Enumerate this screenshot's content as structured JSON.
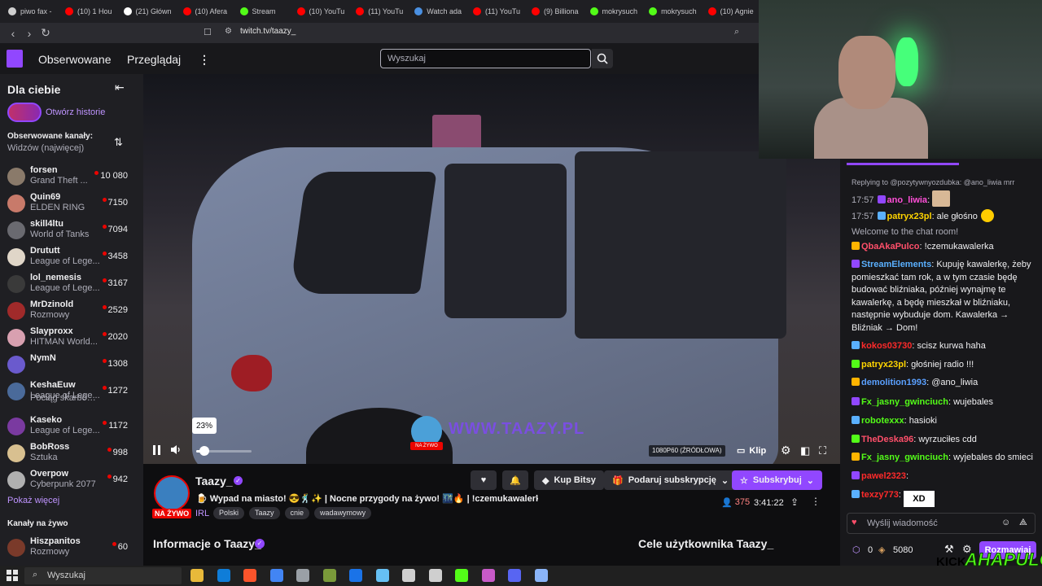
{
  "browser": {
    "tabs": [
      {
        "label": "piwo fax -",
        "color": "#cfcfcf"
      },
      {
        "label": "(10) 1 Hou",
        "color": "#ff0000"
      },
      {
        "label": "(21) Główn",
        "color": "#ffffff"
      },
      {
        "label": "(10) Afera",
        "color": "#ff0000"
      },
      {
        "label": "Stream",
        "color": "#53fc18"
      },
      {
        "label": "(10) YouTu",
        "color": "#ff0000"
      },
      {
        "label": "(11) YouTu",
        "color": "#ff0000"
      },
      {
        "label": "Watch ada",
        "color": "#4a90e2"
      },
      {
        "label": "(11) YouTu",
        "color": "#ff0000"
      },
      {
        "label": "(9) Billiona",
        "color": "#ff0000"
      },
      {
        "label": "mokrysuch",
        "color": "#53fc18"
      },
      {
        "label": "mokrysuch",
        "color": "#53fc18"
      },
      {
        "label": "(10) Agnie",
        "color": "#ff0000"
      }
    ],
    "url": "twitch.tv/taazy_"
  },
  "topnav": {
    "followed": "Obserwowane",
    "browse": "Przeglądaj",
    "more": "⋮",
    "search_placeholder": "Wyszukaj"
  },
  "sidebar": {
    "for_you": "Dla ciebie",
    "collapse": "⇤",
    "stories": "Otwórz historie",
    "followed_label": "Obserwowane kanały:",
    "sort_label": "Widzów (najwięcej)",
    "sort_icon": "⇅",
    "channels": [
      {
        "name": "forsen",
        "game": "Grand Theft ...",
        "viewers": "10 080",
        "color": "#8a7a6a"
      },
      {
        "name": "Quin69",
        "game": "ELDEN RING",
        "viewers": "7150",
        "color": "#c87a6a"
      },
      {
        "name": "skill4ltu",
        "game": "World of Tanks",
        "viewers": "7094",
        "color": "#6a6a70"
      },
      {
        "name": "Drututt",
        "game": "League of Lege...",
        "viewers": "3458",
        "color": "#e0d6c8"
      },
      {
        "name": "lol_nemesis",
        "game": "League of Lege...",
        "viewers": "3167",
        "color": "#3a3a3a"
      },
      {
        "name": "MrDzinold",
        "game": "Rozmowy",
        "viewers": "2529",
        "color": "#a02a2a"
      },
      {
        "name": "Slayproxx",
        "game": "HITMAN World...",
        "viewers": "2020",
        "color": "#d8a0b0"
      },
      {
        "name": "NymN",
        "game": "",
        "viewers": "1308",
        "color": "#6a5acd"
      },
      {
        "name": "KeshaEuw",
        "game": "League of Lege...",
        "viewers": "1272",
        "color": "#4a6a9a"
      },
      {
        "name": "",
        "game": "Pociąg skarbów • P...",
        "viewers": "",
        "color": ""
      },
      {
        "name": "Kaseko",
        "game": "League of Lege...",
        "viewers": "1172",
        "color": "#7a3aa0"
      },
      {
        "name": "BobRoss",
        "game": "Sztuka",
        "viewers": "998",
        "color": "#d8c090"
      },
      {
        "name": "Overpow",
        "game": "Cyberpunk 2077",
        "viewers": "942",
        "color": "#b0b0b0"
      }
    ],
    "show_more": "Pokaż więcej",
    "live_channels": "Kanały na żywo",
    "live": [
      {
        "name": "Hiszpanitos",
        "game": "Rozmowy",
        "viewers": "60",
        "color": "#7a3a2a"
      }
    ]
  },
  "player": {
    "volume_percent": 23,
    "volume_tip": "23%",
    "quality": "1080P60 (ŹRÓDŁOWA)",
    "clip": "Klip",
    "watermark": "WWW.TAAZY.PL",
    "watermark_live": "NA ŻYWO"
  },
  "stream": {
    "streamer": "Taazy_",
    "live_badge": "NA ŻYWO",
    "title": "🍺 Wypad na miasto! 😎🕺✨ | Nocne przygody na żywo! 🌃🔥 | !czemukawalerka",
    "category": "IRL",
    "tags": [
      "Polski",
      "Taazy",
      "cnie",
      "wadawymowy"
    ],
    "viewers": "375",
    "uptime": "3:41:22",
    "bits": "Kup Bitsy",
    "gift": "Podaruj subskrypcję",
    "subscribe": "Subskrybuj",
    "about": "Informacje o Taazy_",
    "goals": "Cele użytkownika Taazy_"
  },
  "chat": {
    "reply_line": "Replying to @pozytywnyozdubka: @ano_liwia mrr",
    "messages": [
      {
        "time": "17:57",
        "user": "ano_liwia",
        "color": "#ff4fd8",
        "text": ":"
      },
      {
        "time": "17:57",
        "user": "patryx23pl",
        "color": "#ffd400",
        "text": ": ale głośno"
      },
      {
        "time": "",
        "user": "",
        "color": "#adadb8",
        "text": "Welcome to the chat room!"
      },
      {
        "time": "",
        "user": "QbaAkaPulco",
        "color": "#ff4f6a",
        "text": ": !czemukawalerka"
      },
      {
        "time": "",
        "user": "StreamElements",
        "color": "#5ab0ff",
        "text": ": Kupuję kawalerkę, żeby pomieszkać tam rok, a w tym czasie będę budować bliźniaka, później wynajmę te kawalerkę, a będę mieszkał w bliźniaku, następnie wybuduje dom. Kawalerka → Bliźniak → Dom!"
      },
      {
        "time": "",
        "user": "kokos03730",
        "color": "#ff2a2a",
        "text": ": scisz kurwa haha"
      },
      {
        "time": "",
        "user": "patryx23pl",
        "color": "#ffd400",
        "text": ": głośniej radio !!!"
      },
      {
        "time": "",
        "user": "demolition1993",
        "color": "#5aa0ff",
        "text": ": @ano_liwia"
      },
      {
        "time": "",
        "user": "Fx_jasny_gwinciuch",
        "color": "#53fc18",
        "text": ": wujebales"
      },
      {
        "time": "",
        "user": "robotexxx",
        "color": "#53fc18",
        "text": ": hasioki"
      },
      {
        "time": "",
        "user": "TheDeska96",
        "color": "#ff4f6a",
        "text": ": wyrzuciłes cdd"
      },
      {
        "time": "",
        "user": "Fx_jasny_gwinciuch",
        "color": "#53fc18",
        "text": ": wyjebales do smieci"
      },
      {
        "time": "",
        "user": "pawel2323",
        "color": "#ff2a2a",
        "text": ":"
      },
      {
        "time": "",
        "user": "texzy773",
        "color": "#ff2a2a",
        "text": ":"
      }
    ],
    "emote_xd": "XD",
    "input_placeholder": "Wyślij wiadomość",
    "points": "0",
    "bits_count": "5080",
    "send": "Rozmawiaj"
  },
  "overlay": {
    "kick": "KICK",
    "name": "AHAPULCO"
  },
  "taskbar": {
    "search": "Wyszukaj"
  }
}
